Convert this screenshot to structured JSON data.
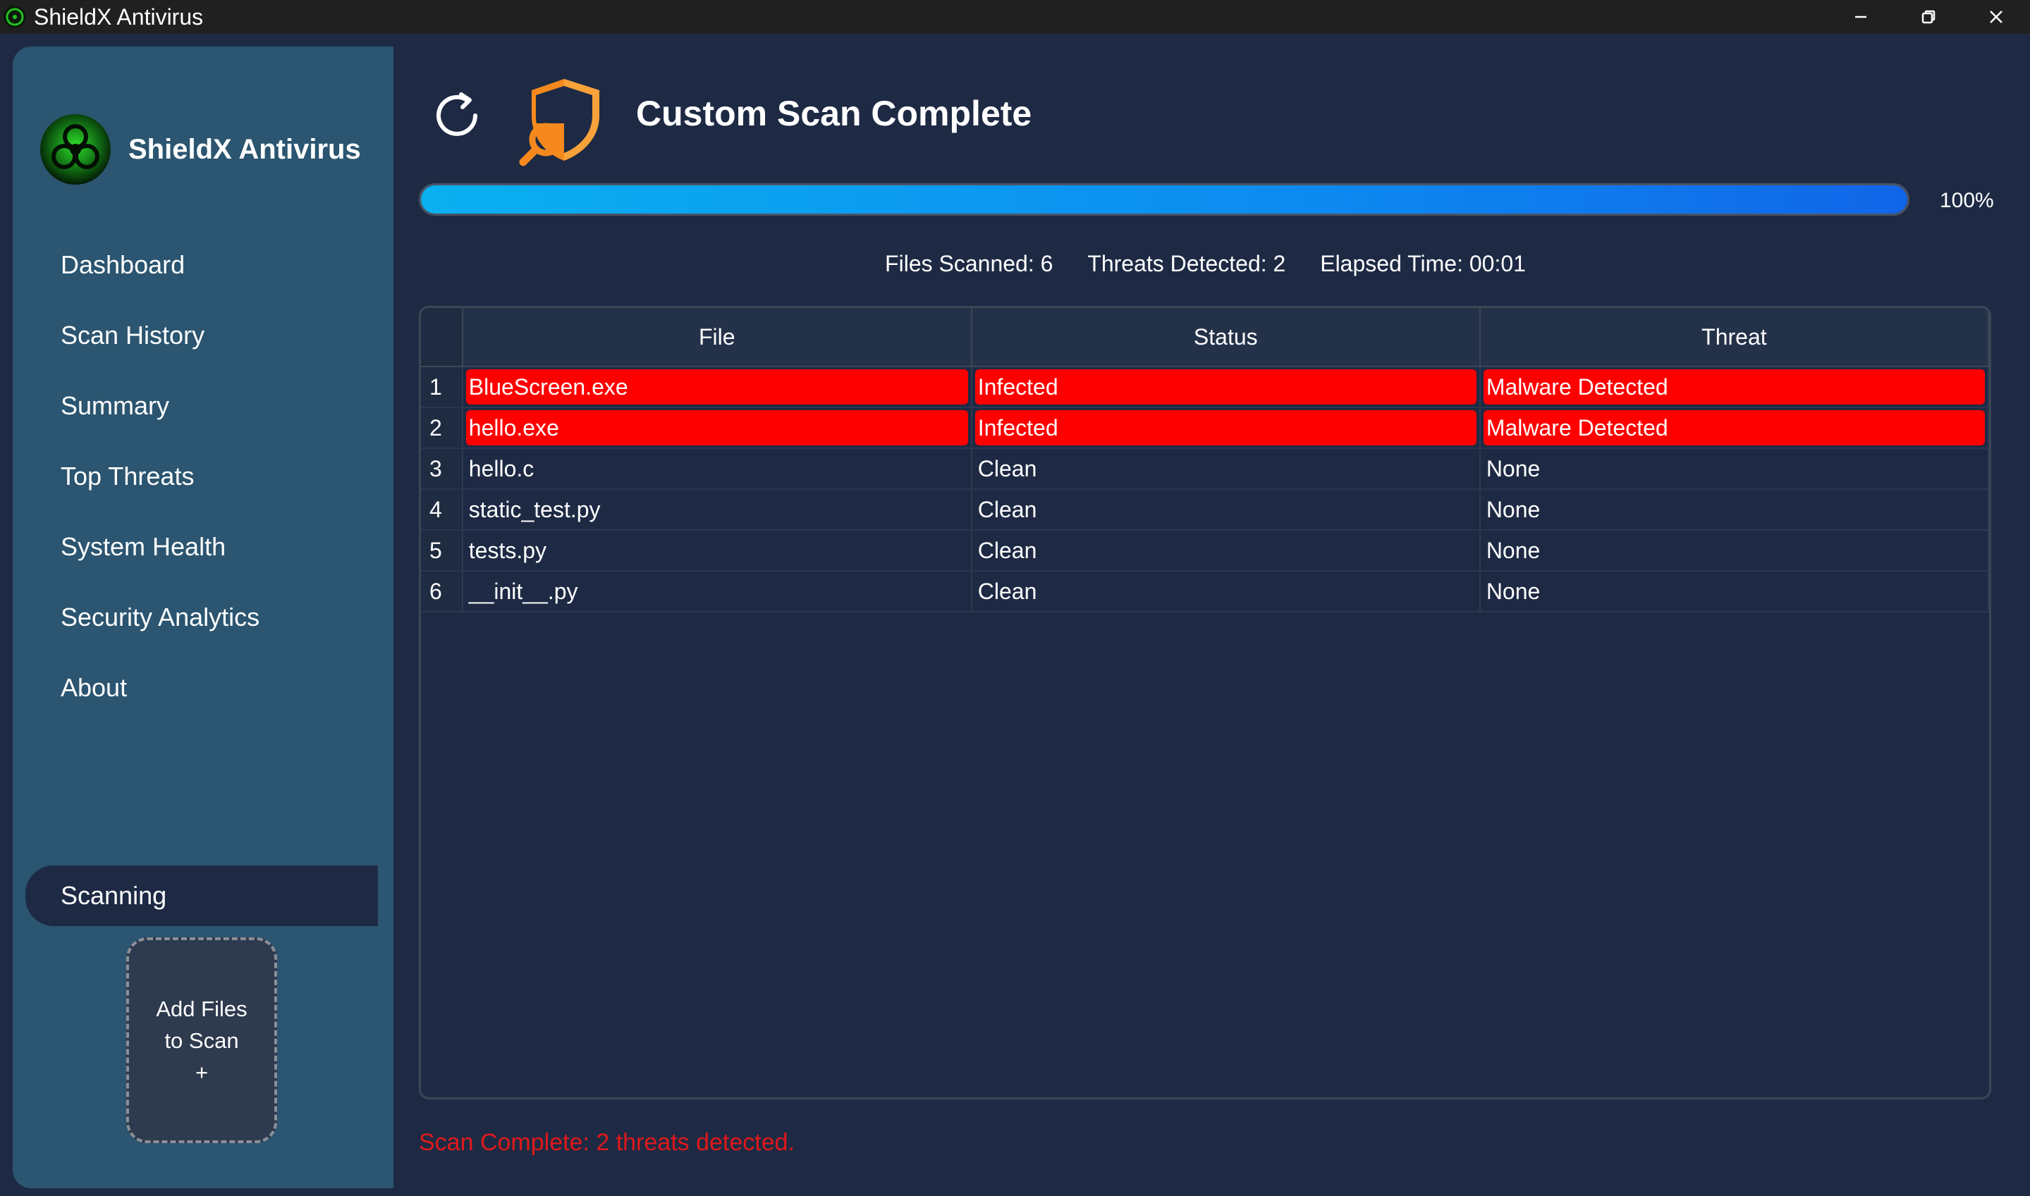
{
  "window": {
    "title": "ShieldX Antivirus"
  },
  "sidebar": {
    "brand": "ShieldX Antivirus",
    "items": [
      {
        "label": "Dashboard"
      },
      {
        "label": "Scan History"
      },
      {
        "label": "Summary"
      },
      {
        "label": "Top Threats"
      },
      {
        "label": "System Health"
      },
      {
        "label": "Security Analytics"
      },
      {
        "label": "About"
      }
    ],
    "active": "Scanning",
    "add_files": {
      "line1": "Add Files",
      "line2": "to Scan",
      "line3": "+"
    }
  },
  "main": {
    "title": "Custom Scan Complete",
    "progress": {
      "value": 100,
      "label": "100%"
    },
    "stats": {
      "files_scanned": "Files Scanned: 6",
      "threats_detected": "Threats Detected: 2",
      "elapsed": "Elapsed Time: 00:01"
    },
    "table": {
      "columns": [
        "File",
        "Status",
        "Threat"
      ],
      "rows": [
        {
          "n": "1",
          "file": "BlueScreen.exe",
          "status": "Infected",
          "threat": "Malware Detected",
          "infected": true
        },
        {
          "n": "2",
          "file": "hello.exe",
          "status": "Infected",
          "threat": "Malware Detected",
          "infected": true
        },
        {
          "n": "3",
          "file": "hello.c",
          "status": "Clean",
          "threat": "None",
          "infected": false
        },
        {
          "n": "4",
          "file": "static_test.py",
          "status": "Clean",
          "threat": "None",
          "infected": false
        },
        {
          "n": "5",
          "file": "tests.py",
          "status": "Clean",
          "threat": "None",
          "infected": false
        },
        {
          "n": "6",
          "file": "__init__.py",
          "status": "Clean",
          "threat": "None",
          "infected": false
        }
      ]
    },
    "status_message": "Scan Complete: 2 threats detected."
  },
  "colors": {
    "infected_row": "#ff0000",
    "sidebar_bg": "#2b5570",
    "main_bg": "#1e2a44",
    "progress": "#0a9cf0",
    "status_message": "#e0191a"
  },
  "icons": {
    "app": "biohazard-icon",
    "refresh": "refresh-icon",
    "scan": "shield-magnifier-icon"
  }
}
